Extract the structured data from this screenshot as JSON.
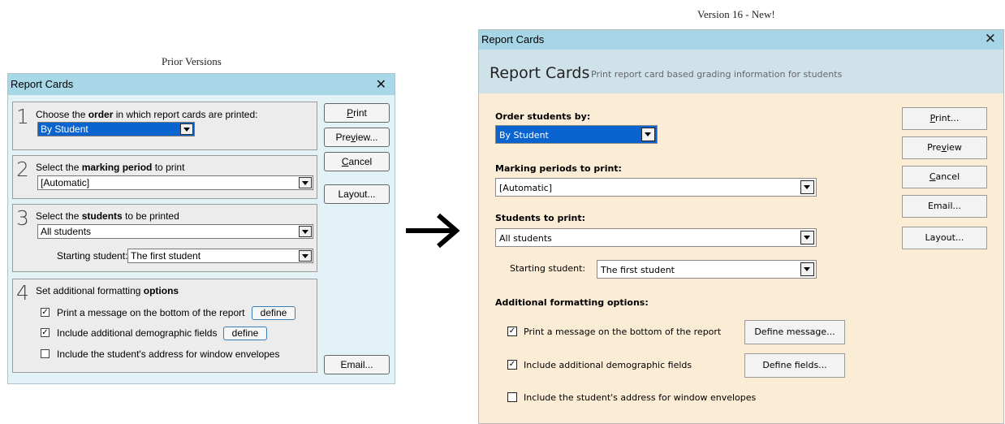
{
  "captions": {
    "prior": "Prior Versions",
    "new": "Version 16 - New!"
  },
  "old_dialog": {
    "title": "Report Cards",
    "close": "✕",
    "section1": {
      "number": "1",
      "label_pre": "Choose the ",
      "label_bold": "order",
      "label_post": " in which report cards are printed:",
      "value": "By Student"
    },
    "section2": {
      "number": "2",
      "label_pre": "Select the ",
      "label_bold": "marking period",
      "label_post": " to print",
      "value": "[Automatic]"
    },
    "section3": {
      "number": "3",
      "label_pre": "Select the ",
      "label_bold": "students",
      "label_post": "  to be printed",
      "value": "All students",
      "starting_label": "Starting student:",
      "starting_value": "The first student"
    },
    "section4": {
      "number": "4",
      "label_pre": "Set additional formatting ",
      "label_bold": "options",
      "options": [
        {
          "label": "Print a message on the bottom of the report",
          "checked": "✓",
          "button": "define"
        },
        {
          "label": "Include additional demographic fields",
          "checked": "✓",
          "button": "define"
        },
        {
          "label": "Include the student's address for window envelopes",
          "checked": ""
        }
      ]
    },
    "buttons": {
      "print_u": "P",
      "print_rest": "rint",
      "preview_pre": "Pre",
      "preview_u": "v",
      "preview_rest": "iew...",
      "cancel_u": "C",
      "cancel_rest": "ancel",
      "layout": "Layout...",
      "email": "Email..."
    }
  },
  "new_dialog": {
    "title": "Report Cards",
    "close": "✕",
    "heading": "Report Cards",
    "subheading": "Print report card based grading information for students",
    "order_label": "Order students by:",
    "order_value": "By Student",
    "marking_label": "Marking periods to print:",
    "marking_value": "[Automatic]",
    "students_label": "Students to print:",
    "students_value": "All students",
    "starting_label": "Starting student:",
    "starting_value": "The first student",
    "options_label": "Additional formatting options:",
    "options": [
      {
        "label": "Print a message on the bottom of the report",
        "checked": "✓",
        "button": "Define message..."
      },
      {
        "label": "Include additional demographic fields",
        "checked": "✓",
        "button": "Define fields..."
      },
      {
        "label": "Include the student's address for window envelopes",
        "checked": ""
      }
    ],
    "buttons": {
      "print_u": "P",
      "print_rest": "rint...",
      "preview_pre": "Pre",
      "preview_u": "v",
      "preview_rest": "iew",
      "cancel_u": "C",
      "cancel_rest": "ancel",
      "email": "Email...",
      "layout": "Layout..."
    }
  },
  "arrow_icon": "right-arrow-icon"
}
